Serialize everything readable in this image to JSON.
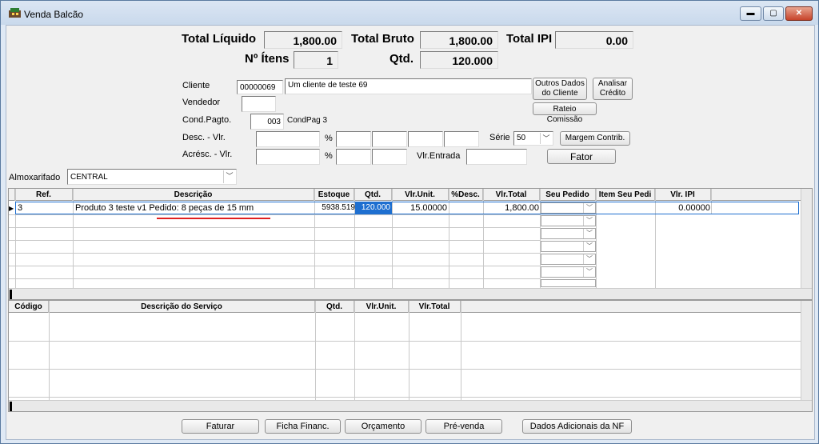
{
  "window": {
    "title": "Venda Balcão"
  },
  "totals": {
    "liquido_label": "Total Líquido",
    "liquido_value": "1,800.00",
    "bruto_label": "Total Bruto",
    "bruto_value": "1,800.00",
    "ipi_label": "Total IPI",
    "ipi_value": "0.00",
    "itens_label": "Nº Ítens",
    "itens_value": "1",
    "qtd_label": "Qtd.",
    "qtd_value": "120.000"
  },
  "form": {
    "cliente_label": "Cliente",
    "cliente_code": "00000069",
    "cliente_name": "Um cliente de teste 69",
    "vendedor_label": "Vendedor",
    "vendedor_value": "",
    "condpag_label": "Cond.Pagto.",
    "condpag_code": "003",
    "condpag_name": "CondPag 3",
    "desc_label": "Desc. - Vlr.",
    "acresc_label": "Acrésc. - Vlr.",
    "pct": "%",
    "serie_label": "Série",
    "serie_value": "50",
    "vlrentrada_label": "Vlr.Entrada",
    "vlrentrada_value": "",
    "almox_label": "Almoxarifado",
    "almox_value": "CENTRAL"
  },
  "buttons": {
    "outros_dados": "Outros Dados do Cliente",
    "analisar": "Analisar Crédito",
    "rateio": "Rateio Comissão",
    "margem": "Margem Contrib.",
    "fator": "Fator",
    "faturar": "Faturar",
    "ficha": "Ficha Financ.",
    "orcamento": "Orçamento",
    "prevenda": "Pré-venda",
    "dados_nf": "Dados Adicionais da NF"
  },
  "products": {
    "columns": [
      "Ref.",
      "Descrição",
      "Estoque",
      "Qtd.",
      "Vlr.Unit.",
      "%Desc.",
      "Vlr.Total",
      "Seu Pedido",
      "Item Seu Pedi",
      "Vlr. IPI"
    ],
    "rows": [
      {
        "ref": "3",
        "descricao": "Produto 3 teste v1 Pedido: 8 peças de 15 mm",
        "estoque": "5938.519",
        "qtd": "120.000",
        "vlr_unit": "15.00000",
        "desc": "",
        "vlr_total": "1,800.00",
        "seu_pedido": "",
        "item_seu_pedido": "",
        "vlr_ipi": "0.00000"
      }
    ]
  },
  "services": {
    "columns": [
      "Código",
      "Descrição do Serviço",
      "Qtd.",
      "Vlr.Unit.",
      "Vlr.Total"
    ]
  },
  "colors": {
    "selection": "#1e6fd0",
    "underline": "#e02020"
  }
}
